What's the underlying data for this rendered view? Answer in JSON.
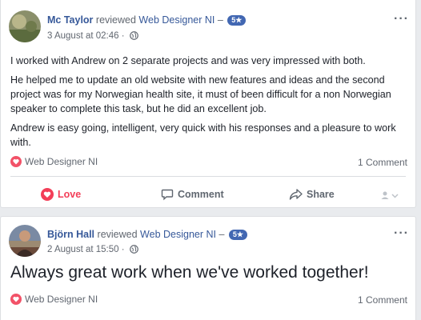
{
  "posts": [
    {
      "author": "Mc Taylor",
      "reviewed_text": "reviewed",
      "page_name": "Web Designer NI",
      "dash": "–",
      "badge": "5★",
      "timestamp": "3 August at 02:46 ·",
      "paragraphs": [
        "I worked with Andrew on 2 separate projects and was very impressed with both.",
        "He helped me to update an old website with new features and ideas and the second project was for my Norwegian health site, it must of been difficult for a non Norwegian speaker to complete this task, but he did an excellent job.",
        "Andrew is easy going, intelligent, very quick with his responses and a pleasure to work with."
      ],
      "recommends": "Web Designer NI",
      "comment_count": "1 Comment",
      "actions": {
        "love": "Love",
        "comment": "Comment",
        "share": "Share"
      }
    },
    {
      "author": "Björn Hall",
      "reviewed_text": "reviewed",
      "page_name": "Web Designer NI",
      "dash": "–",
      "badge": "5★",
      "timestamp": "2 August at 15:50 ·",
      "text": "Always great work when we've worked together!",
      "recommends": "Web Designer NI",
      "comment_count": "1 Comment"
    }
  ],
  "colors": {
    "link": "#365899",
    "love": "#f33e58",
    "badge": "#4267b2",
    "recommend": "#f25268"
  },
  "icons": [
    "globe-icon",
    "recommend-icon",
    "heart-icon",
    "comment-icon",
    "share-icon",
    "more-icon"
  ]
}
